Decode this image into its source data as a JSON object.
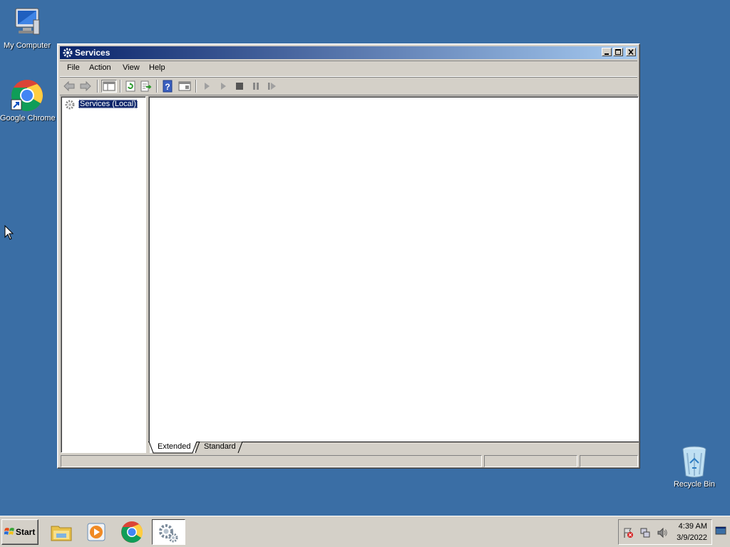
{
  "desktop": {
    "icons": [
      {
        "label": "My Computer",
        "icon": "computer-icon"
      },
      {
        "label": "Google Chrome",
        "icon": "chrome-icon"
      },
      {
        "label": "Recycle Bin",
        "icon": "recycle-bin-icon"
      }
    ]
  },
  "window": {
    "title": "Services",
    "title_icon": "gear-icon",
    "controls": [
      "minimize",
      "maximize",
      "close"
    ],
    "menu": [
      {
        "label": "File"
      },
      {
        "label": "Action"
      },
      {
        "label": "View"
      },
      {
        "label": "Help"
      }
    ],
    "toolbar": [
      "back-arrow-icon",
      "forward-arrow-icon",
      "show-hide-tree-icon",
      "refresh-icon",
      "export-list-icon",
      "help-icon",
      "properties-icon",
      "start-service-icon",
      "start-service-alt-icon",
      "stop-service-icon",
      "pause-service-icon",
      "restart-service-icon"
    ],
    "tree": {
      "selected_item": "Services (Local)"
    },
    "tabs": [
      {
        "label": "Extended",
        "active": true
      },
      {
        "label": "Standard",
        "active": false
      }
    ]
  },
  "taskbar": {
    "start_label": "Start",
    "pinned": [
      "file-explorer-icon",
      "media-player-icon",
      "chrome-icon",
      "services-icon"
    ],
    "clock": {
      "time": "4:39 AM",
      "date": "3/9/2022"
    }
  },
  "colors": {
    "desktop": "#3a6ea5",
    "titlebar_start": "#0a246a",
    "titlebar_end": "#a6caf0",
    "chrome_face": "#d4d0c8",
    "selection": "#0a246a"
  }
}
